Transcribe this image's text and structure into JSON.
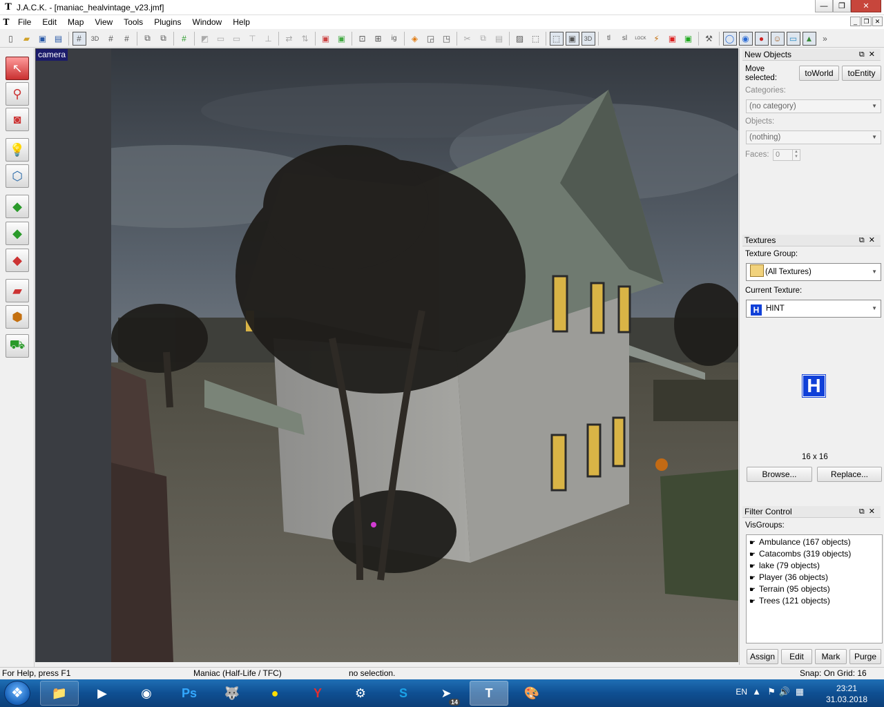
{
  "window": {
    "title": "J.A.C.K. - [maniac_healvintage_v23.jmf]",
    "app_icon": "jack-logo-icon",
    "minimize": "—",
    "restore": "❐",
    "close": "✕"
  },
  "menubar": {
    "items": [
      "File",
      "Edit",
      "Map",
      "View",
      "Tools",
      "Plugins",
      "Window",
      "Help"
    ]
  },
  "viewport": {
    "label": "camera"
  },
  "new_objects": {
    "title": "New Objects",
    "move_selected_label": "Move selected:",
    "to_world": "toWorld",
    "to_entity": "toEntity",
    "categories_label": "Categories:",
    "categories_value": "(no category)",
    "objects_label": "Objects:",
    "objects_value": "(nothing)",
    "faces_label": "Faces:",
    "faces_value": "0"
  },
  "textures": {
    "title": "Textures",
    "group_label": "Texture Group:",
    "group_value": "(All Textures)",
    "current_label": "Current Texture:",
    "current_value": "HINT",
    "preview_glyph": "H",
    "size": "16 x 16",
    "browse": "Browse...",
    "replace": "Replace..."
  },
  "filter_control": {
    "title": "Filter Control",
    "visgroups_label": "VisGroups:",
    "visgroups": [
      "Ambulance (167 objects)",
      "Catacombs (319 objects)",
      "lake (79 objects)",
      "Player (36 objects)",
      "Terrain (95 objects)",
      "Trees (121 objects)"
    ],
    "assign": "Assign",
    "edit": "Edit",
    "mark": "Mark",
    "purge": "Purge"
  },
  "status": {
    "help": "For Help, press F1",
    "game": "Maniac (Half-Life / TFC)",
    "selection": "no selection.",
    "snap": "Snap: On Grid: 16"
  },
  "taskbar": {
    "lang": "EN",
    "time": "23:21",
    "date": "31.03.2018",
    "telegram_badge": "14"
  }
}
